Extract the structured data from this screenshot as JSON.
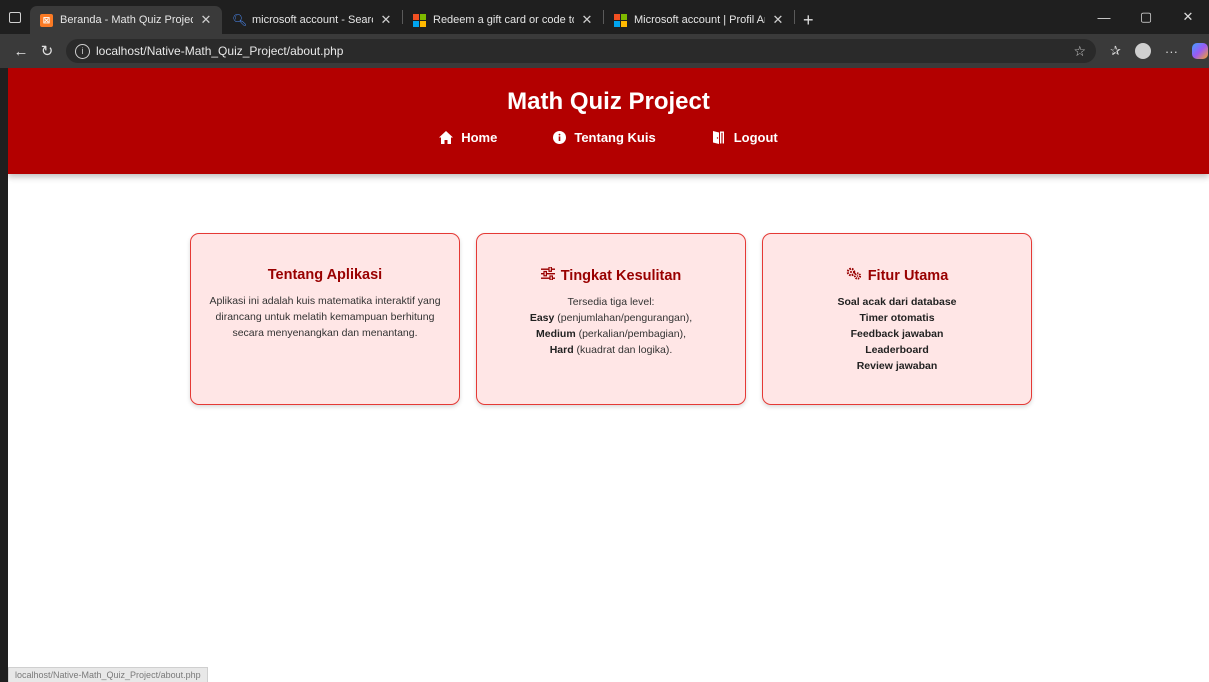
{
  "browser": {
    "tabs": [
      {
        "title": "Beranda - Math Quiz Project",
        "favicon": "xampp-icon",
        "active": true
      },
      {
        "title": "microsoft account - Search",
        "favicon": "search-icon",
        "active": false
      },
      {
        "title": "Redeem a gift card or code to yo",
        "favicon": "microsoft-icon",
        "active": false
      },
      {
        "title": "Microsoft account | Profil Anda",
        "favicon": "microsoft-icon",
        "active": false
      }
    ],
    "new_tab": "+",
    "url": "localhost/Native-Math_Quiz_Project/about.php",
    "status_url": "localhost/Native-Math_Quiz_Project/about.php"
  },
  "site": {
    "title": "Math Quiz Project",
    "nav": {
      "home": "Home",
      "about": "Tentang Kuis",
      "logout": "Logout"
    }
  },
  "cards": {
    "about": {
      "title": "Tentang Aplikasi",
      "text": "Aplikasi ini adalah kuis matematika interaktif yang dirancang untuk melatih kemampuan berhitung secara menyenangkan dan menantang."
    },
    "levels": {
      "title": "Tingkat Kesulitan",
      "intro": "Tersedia tiga level:",
      "easy": "Easy",
      "easy_desc": " (penjumlahan/pengurangan),",
      "medium": "Medium",
      "medium_desc": " (perkalian/pembagian),",
      "hard": "Hard",
      "hard_desc": " (kuadrat dan logika)."
    },
    "features": {
      "title": "Fitur Utama",
      "items": [
        "Soal acak dari database",
        "Timer otomatis",
        "Feedback jawaban",
        "Leaderboard",
        "Review jawaban"
      ]
    }
  },
  "colors": {
    "header_bg": "#b30000",
    "card_bg": "#ffe6e6",
    "card_border": "#e53935",
    "card_title": "#990000"
  }
}
